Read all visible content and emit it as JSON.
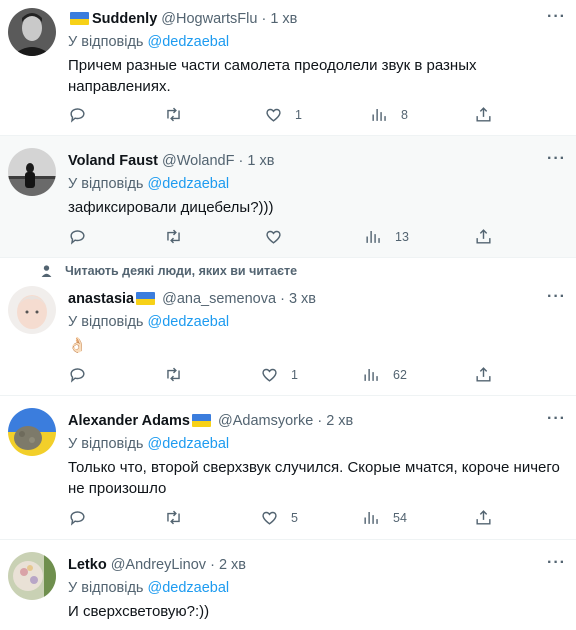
{
  "tweets": [
    {
      "name": "Suddenly",
      "handle": "@HogwartsFlu",
      "dot": "·",
      "time": "1 хв",
      "reply_prefix": "У відповідь",
      "reply_to": "@dedzaebal",
      "text": "Причем разные части самолета преодолели звук в разных направлениях.",
      "likes": "1",
      "views": "8",
      "flag": "before"
    },
    {
      "name": "Voland Faust",
      "handle": "@WolandF",
      "dot": "·",
      "time": "1 хв",
      "reply_prefix": "У відповідь",
      "reply_to": "@dedzaebal",
      "text": "зафиксировали дицебелы?)))",
      "likes": "",
      "views": "13"
    },
    {
      "name": "anastasia",
      "handle": "@ana_semenova",
      "dot": "·",
      "time": "3 хв",
      "reply_prefix": "У відповідь",
      "reply_to": "@dedzaebal",
      "text": "👌🏻",
      "likes": "1",
      "views": "62",
      "social": "Читають деякі люди, яких ви читаєте",
      "flag": "after"
    },
    {
      "name": "Alexander Adams",
      "handle": "@Adamsyorke",
      "dot": "·",
      "time": "2 хв",
      "reply_prefix": "У відповідь",
      "reply_to": "@dedzaebal",
      "text": "Только что, второй сверхзвук случился. Скорые мчатся, короче ничего не произошло",
      "likes": "5",
      "views": "54",
      "flag": "after"
    },
    {
      "name": "Letko",
      "handle": "@AndreyLinov",
      "dot": "·",
      "time": "2 хв",
      "reply_prefix": "У відповідь",
      "reply_to": "@dedzaebal",
      "text": "И сверхсветовую?:))",
      "likes": "",
      "views": ""
    }
  ],
  "icons": {
    "reply": "reply-icon",
    "retweet": "retweet-icon",
    "like": "heart-icon",
    "views": "views-icon",
    "share": "share-icon",
    "more": "more-icon"
  },
  "colors": {
    "accent": "#1d9bf0",
    "muted": "#536471",
    "flag_blue": "#3b7ddd",
    "flag_yellow": "#f7d117"
  }
}
